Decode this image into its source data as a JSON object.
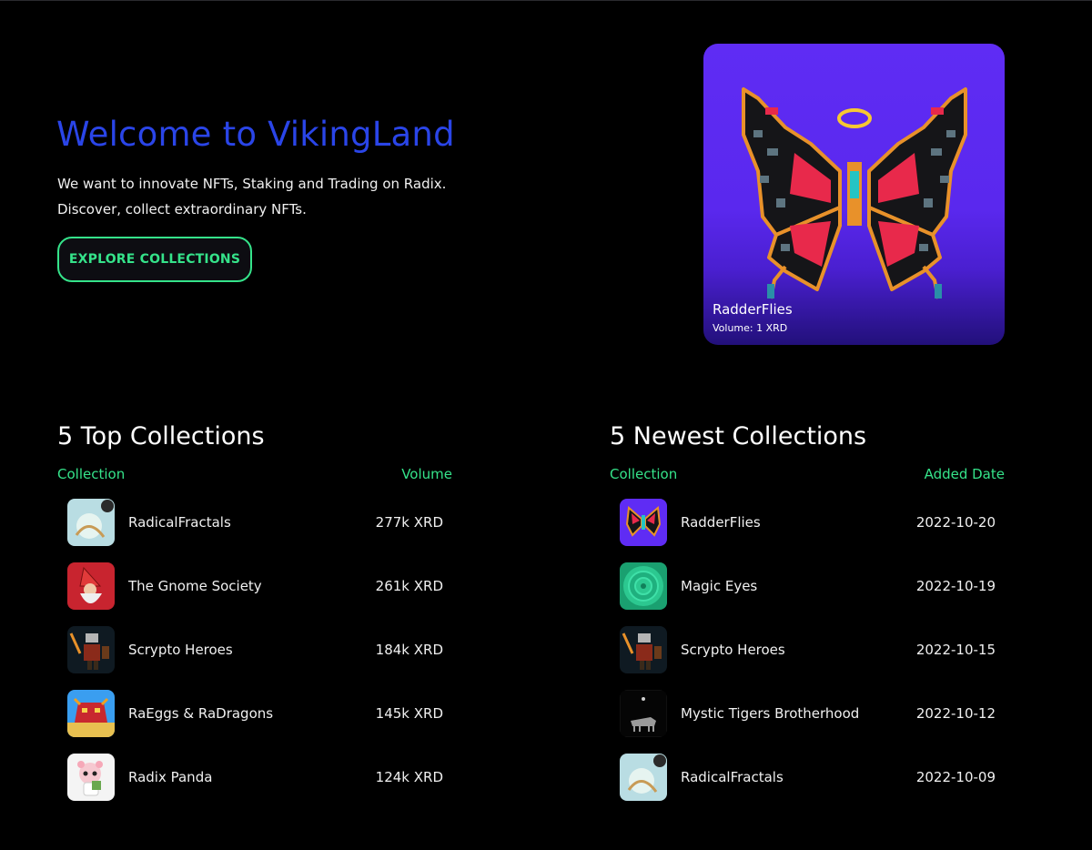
{
  "hero": {
    "title": "Welcome to VikingLand",
    "line1": "We want to innovate NFTs, Staking and Trading on Radix.",
    "line2": "Discover, collect extraordinary NFTs.",
    "button_label": "EXPLORE COLLECTIONS"
  },
  "featured": {
    "name": "RadderFlies",
    "volume": "Volume: 1 XRD",
    "icon": "pixel-butterfly"
  },
  "top": {
    "title": "5 Top Collections",
    "col_collection": "Collection",
    "col_value": "Volume",
    "rows": [
      {
        "name": "RadicalFractals",
        "value": "277k XRD",
        "icon": "fractal-thumbnail"
      },
      {
        "name": "The Gnome Society",
        "value": "261k XRD",
        "icon": "gnome-thumbnail"
      },
      {
        "name": "Scrypto Heroes",
        "value": "184k XRD",
        "icon": "viking-hero-thumbnail"
      },
      {
        "name": "RaEggs & RaDragons",
        "value": "145k XRD",
        "icon": "dragon-thumbnail"
      },
      {
        "name": "Radix Panda",
        "value": "124k XRD",
        "icon": "panda-thumbnail"
      }
    ]
  },
  "newest": {
    "title": "5 Newest Collections",
    "col_collection": "Collection",
    "col_value": "Added Date",
    "rows": [
      {
        "name": "RadderFlies",
        "value": "2022-10-20",
        "icon": "butterfly-thumbnail"
      },
      {
        "name": "Magic Eyes",
        "value": "2022-10-19",
        "icon": "magic-eye-thumbnail"
      },
      {
        "name": "Scrypto Heroes",
        "value": "2022-10-15",
        "icon": "viking-hero-thumbnail"
      },
      {
        "name": "Mystic Tigers Brotherhood",
        "value": "2022-10-12",
        "icon": "tiger-thumbnail"
      },
      {
        "name": "RadicalFractals",
        "value": "2022-10-09",
        "icon": "fractal-thumbnail"
      }
    ]
  },
  "colors": {
    "accent_green": "#35e38a",
    "title_blue": "#2a45e8",
    "card_purple": "#5f2cf4",
    "background": "#000000"
  }
}
